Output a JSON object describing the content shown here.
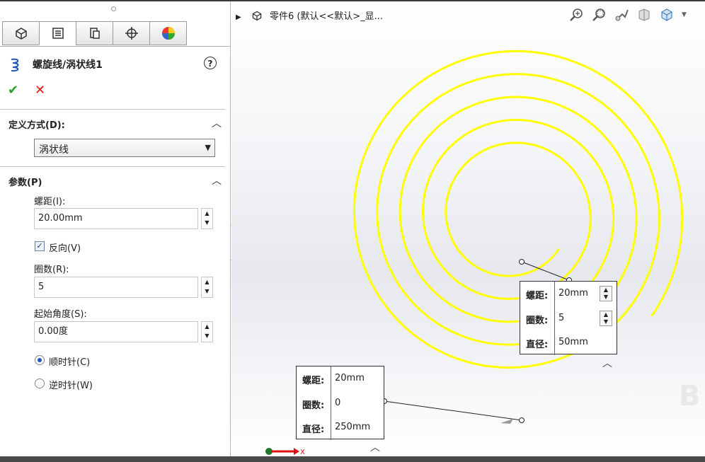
{
  "panel": {
    "feature_title": "螺旋线/涡状线1",
    "help": "?",
    "ok": "✔",
    "cancel": "✕",
    "definition": {
      "title": "定义方式(D):",
      "selected": "涡状线"
    },
    "params": {
      "title": "参数(P)",
      "pitch_label": "螺距(I):",
      "pitch_value": "20.00mm",
      "reverse_label": "反向(V)",
      "reverse_checked": true,
      "revs_label": "圈数(R):",
      "revs_value": "5",
      "start_angle_label": "起始角度(S):",
      "start_angle_value": "0.00度",
      "clockwise_label": "顺时针(C)",
      "counterclockwise_label": "逆时针(W)",
      "direction": "clockwise"
    }
  },
  "viewport": {
    "tree_text": "零件6  (默认<<默认>_显...",
    "callout_inner": {
      "pitch_label": "螺距:",
      "pitch": "20mm",
      "revs_label": "圈数:",
      "revs": "5",
      "diameter_label": "直径:",
      "diameter": "50mm"
    },
    "callout_outer": {
      "pitch_label": "螺距:",
      "pitch": "20mm",
      "revs_label": "圈数:",
      "revs": "0",
      "diameter_label": "直径:",
      "diameter": "250mm"
    },
    "triad_x": "X",
    "spiral_color": "#ffff00",
    "accent_color": "#1e57b8"
  },
  "icons": [
    "part-icon",
    "property-manager-icon",
    "config-manager-icon",
    "dimxpert-icon",
    "display-manager-icon",
    "helix-icon",
    "help-icon",
    "zoom-to-fit-icon",
    "zoom-area-icon",
    "previous-view-icon",
    "section-view-icon",
    "view-orientation-icon"
  ]
}
